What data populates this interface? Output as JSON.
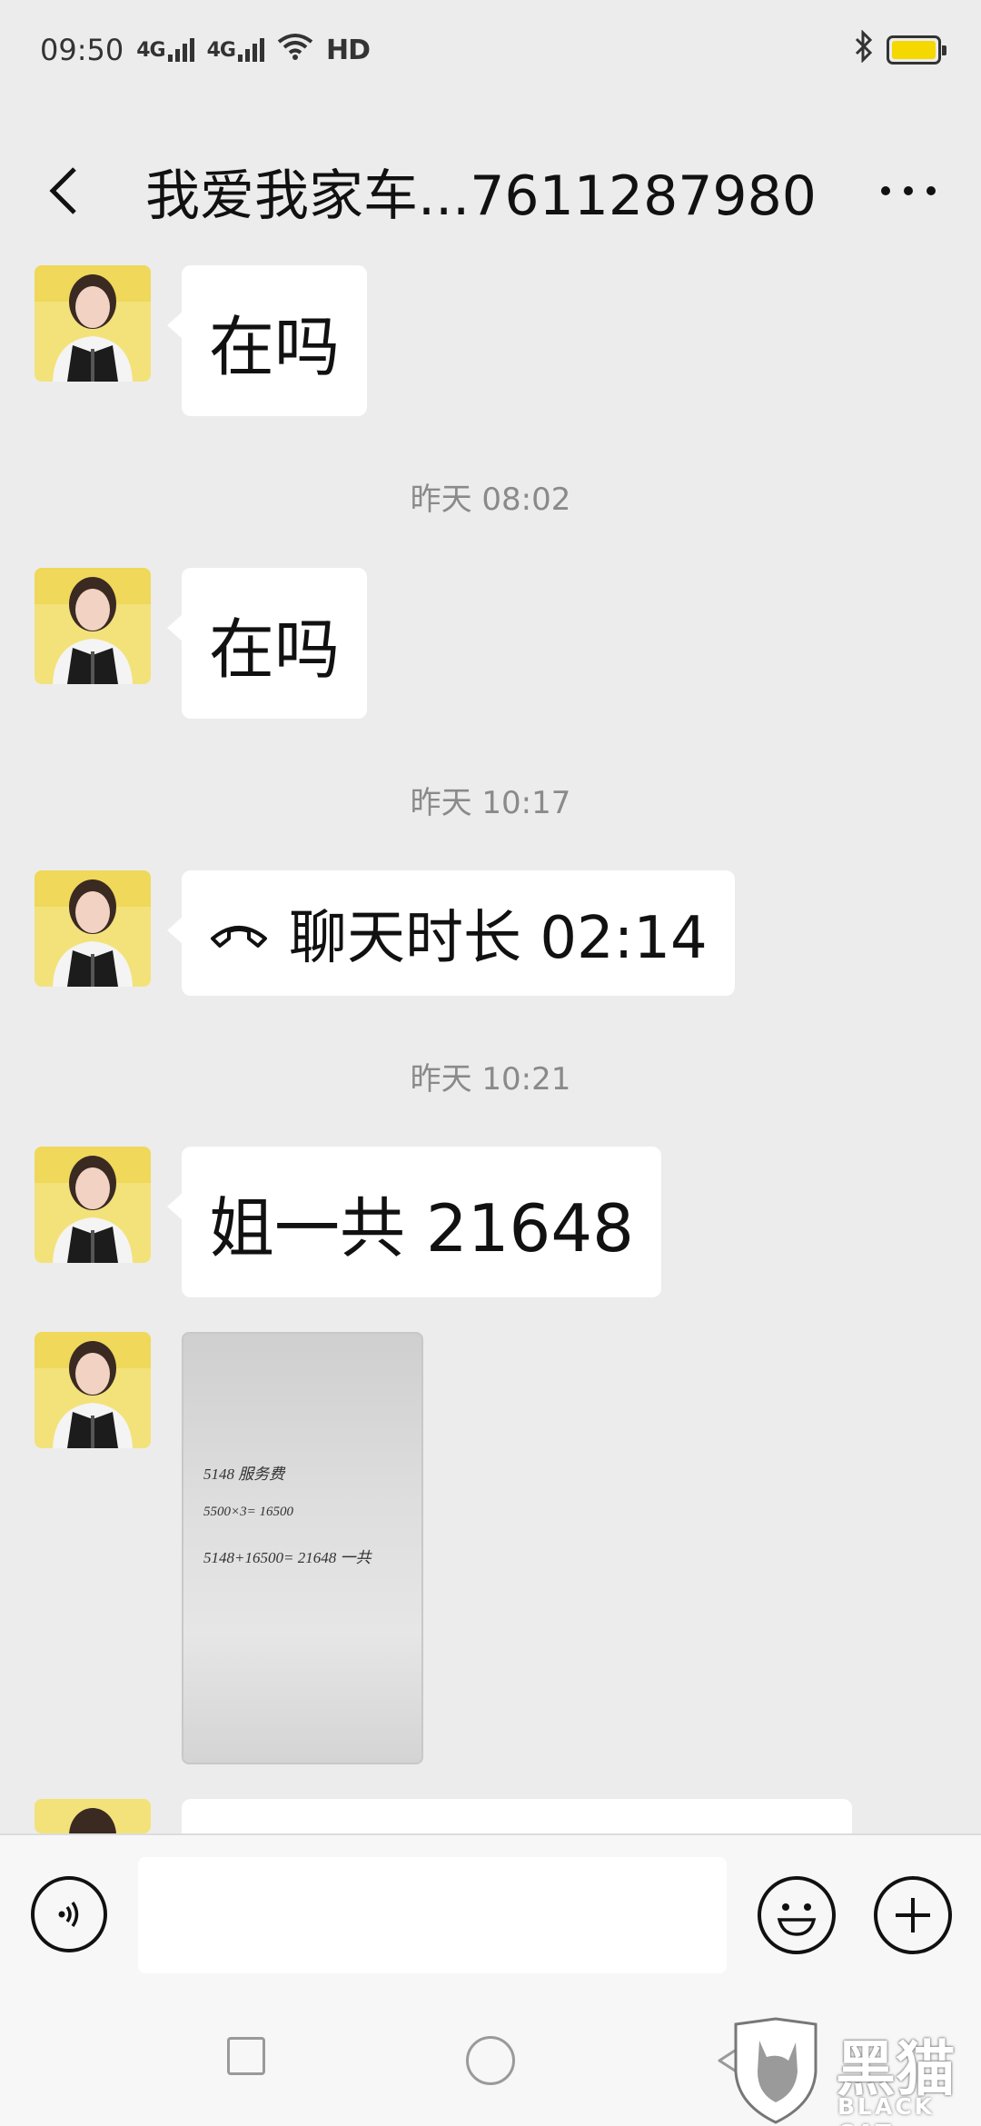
{
  "status_bar": {
    "time": "09:50",
    "network_1": "4G",
    "network_2": "4G",
    "hd": "HD",
    "battery_color": "#f5d800"
  },
  "header": {
    "title": "我爱我家车...7611287980",
    "back_icon": "chevron-left-icon",
    "more_icon": "more-dots-icon"
  },
  "messages": [
    {
      "type": "text",
      "text": "在吗"
    },
    {
      "type": "timestamp",
      "text": "昨天 08:02"
    },
    {
      "type": "text",
      "text": "在吗"
    },
    {
      "type": "timestamp",
      "text": "昨天 10:17"
    },
    {
      "type": "call",
      "text": "聊天时长 02:14",
      "icon": "phone-hangup-icon"
    },
    {
      "type": "timestamp",
      "text": "昨天 10:21"
    },
    {
      "type": "text",
      "text": "姐一共 21648"
    },
    {
      "type": "image",
      "handwriting": [
        "5148   服务费",
        "5500×3= 16500",
        "5148+16500= 21648 一共"
      ]
    }
  ],
  "input_bar": {
    "placeholder": "",
    "voice_icon": "voice-icon",
    "emoji_icon": "emoji-icon",
    "plus_icon": "plus-icon"
  },
  "nav_bar": {
    "recents_icon": "recents-square-icon",
    "home_icon": "home-circle-icon",
    "back_icon": "back-triangle-icon"
  },
  "watermark": {
    "cn": "黑猫",
    "en": "BLACK CAT"
  }
}
